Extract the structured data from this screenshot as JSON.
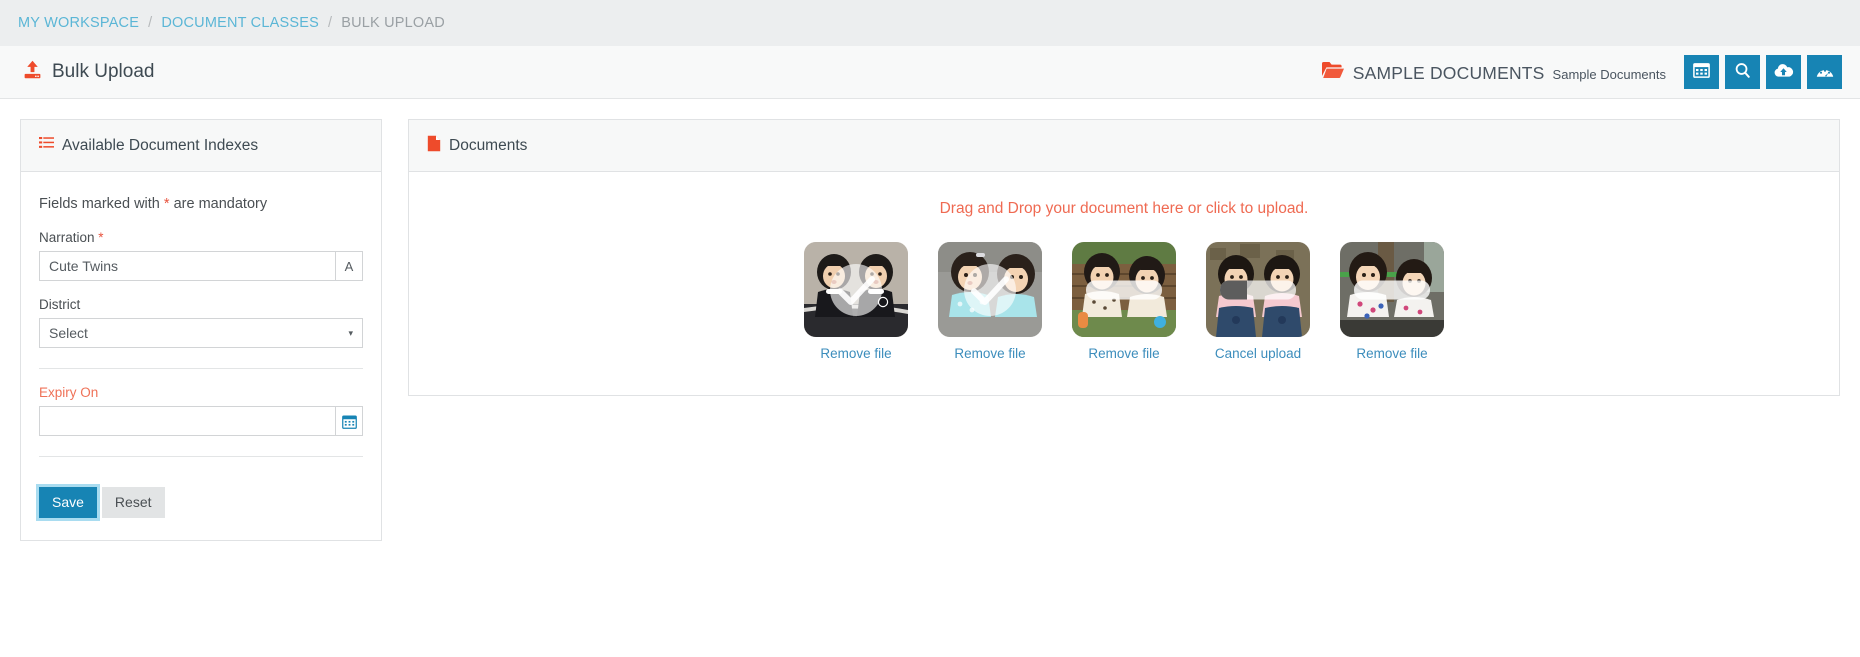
{
  "breadcrumb": {
    "items": [
      {
        "label": "MY WORKSPACE",
        "current": false
      },
      {
        "label": "DOCUMENT CLASSES",
        "current": false
      },
      {
        "label": "BULK UPLOAD",
        "current": true
      }
    ],
    "separator": "/"
  },
  "header": {
    "title": "Bulk Upload",
    "upload_icon": "upload-icon",
    "folder_icon": "open-folder-icon",
    "folder_name": "SAMPLE DOCUMENTS",
    "folder_subtitle": "Sample Documents",
    "buttons": [
      {
        "name": "grid-view-button",
        "icon": "grid-icon"
      },
      {
        "name": "search-button",
        "icon": "search-icon"
      },
      {
        "name": "cloud-upload-button",
        "icon": "cloud-upload-icon"
      },
      {
        "name": "dashboard-button",
        "icon": "dashboard-gauge-icon"
      }
    ],
    "accent_color": "#1784b4"
  },
  "left_panel": {
    "icon": "list-icon",
    "title": "Available Document Indexes",
    "mandatory_note_prefix": "Fields marked with ",
    "mandatory_marker": "*",
    "mandatory_note_suffix": " are mandatory",
    "fields": {
      "narration": {
        "label": "Narration",
        "required_marker": "*",
        "value": "Cute Twins",
        "addon_label": "A",
        "addon_icon": "font-style-icon"
      },
      "district": {
        "label": "District",
        "value": "Select",
        "caret": "▾"
      },
      "expiry": {
        "label": "Expiry On",
        "value": "",
        "placeholder": "",
        "addon_icon": "calendar-icon"
      }
    },
    "save_label": "Save",
    "reset_label": "Reset"
  },
  "right_panel": {
    "icon": "document-file-icon",
    "title": "Documents",
    "drop_text": "Drag and Drop your document here or click to upload.",
    "thumbnails": [
      {
        "alt": "twin-girls-black-outfits",
        "action_label": "Remove file",
        "state": "complete",
        "progress": 100,
        "overlay": "check"
      },
      {
        "alt": "twin-girls-blue-dresses",
        "action_label": "Remove file",
        "state": "complete",
        "progress": 100,
        "overlay": "check"
      },
      {
        "alt": "twin-girls-bench-park",
        "action_label": "Remove file",
        "state": "complete",
        "progress": 100,
        "overlay": "bar-done"
      },
      {
        "alt": "twin-girls-denim-overalls",
        "action_label": "Cancel upload",
        "state": "uploading",
        "progress": 35,
        "overlay": "bar"
      },
      {
        "alt": "twin-girls-floral-dresses",
        "action_label": "Remove file",
        "state": "complete",
        "progress": 100,
        "overlay": "bar-done"
      }
    ]
  }
}
